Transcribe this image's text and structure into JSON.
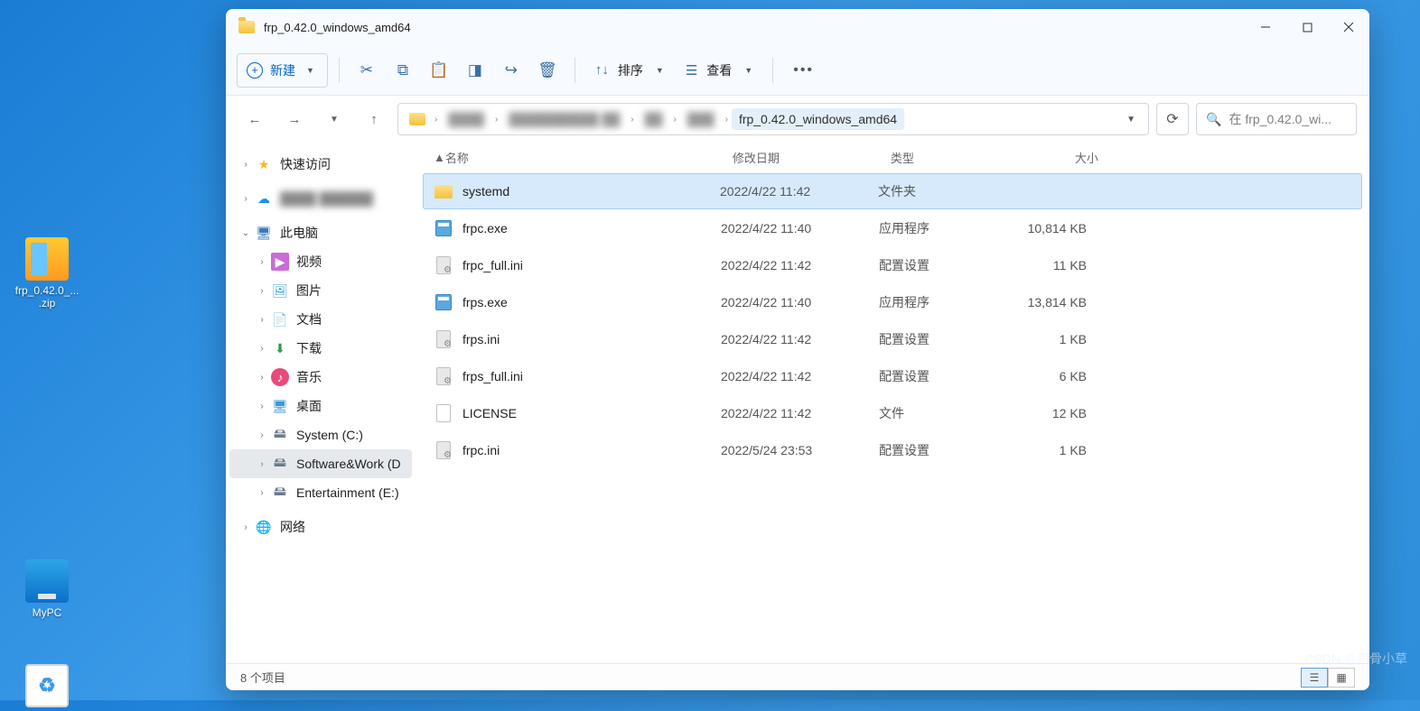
{
  "desktop": {
    "zip_label": "frp_0.42.0_...\n.zip",
    "mypc_label": "MyPC"
  },
  "window": {
    "title": "frp_0.42.0_windows_amd64"
  },
  "toolbar": {
    "new_label": "新建",
    "sort_label": "排序",
    "view_label": "查看"
  },
  "address": {
    "current": "frp_0.42.0_windows_amd64"
  },
  "search": {
    "placeholder": "在 frp_0.42.0_wi..."
  },
  "sidebar": {
    "quick_access": "快速访问",
    "this_pc": "此电脑",
    "videos": "视频",
    "pictures": "图片",
    "documents": "文档",
    "downloads": "下载",
    "music": "音乐",
    "desktop": "桌面",
    "system_c": "System (C:)",
    "software_d": "Software&Work (D",
    "entertainment_e": "Entertainment (E:)",
    "network": "网络"
  },
  "columns": {
    "name": "名称",
    "date": "修改日期",
    "type": "类型",
    "size": "大小"
  },
  "files": [
    {
      "name": "systemd",
      "date": "2022/4/22 11:42",
      "type": "文件夹",
      "size": "",
      "icon": "folder",
      "selected": true
    },
    {
      "name": "frpc.exe",
      "date": "2022/4/22 11:40",
      "type": "应用程序",
      "size": "10,814 KB",
      "icon": "exe"
    },
    {
      "name": "frpc_full.ini",
      "date": "2022/4/22 11:42",
      "type": "配置设置",
      "size": "11 KB",
      "icon": "ini"
    },
    {
      "name": "frps.exe",
      "date": "2022/4/22 11:40",
      "type": "应用程序",
      "size": "13,814 KB",
      "icon": "exe"
    },
    {
      "name": "frps.ini",
      "date": "2022/4/22 11:42",
      "type": "配置设置",
      "size": "1 KB",
      "icon": "ini"
    },
    {
      "name": "frps_full.ini",
      "date": "2022/4/22 11:42",
      "type": "配置设置",
      "size": "6 KB",
      "icon": "ini"
    },
    {
      "name": "LICENSE",
      "date": "2022/4/22 11:42",
      "type": "文件",
      "size": "12 KB",
      "icon": "file"
    },
    {
      "name": "frpc.ini",
      "date": "2022/5/24 23:53",
      "type": "配置设置",
      "size": "1 KB",
      "icon": "ini"
    }
  ],
  "status": {
    "count": "8 个项目"
  },
  "watermark": "CSDN @鸡骨小草"
}
